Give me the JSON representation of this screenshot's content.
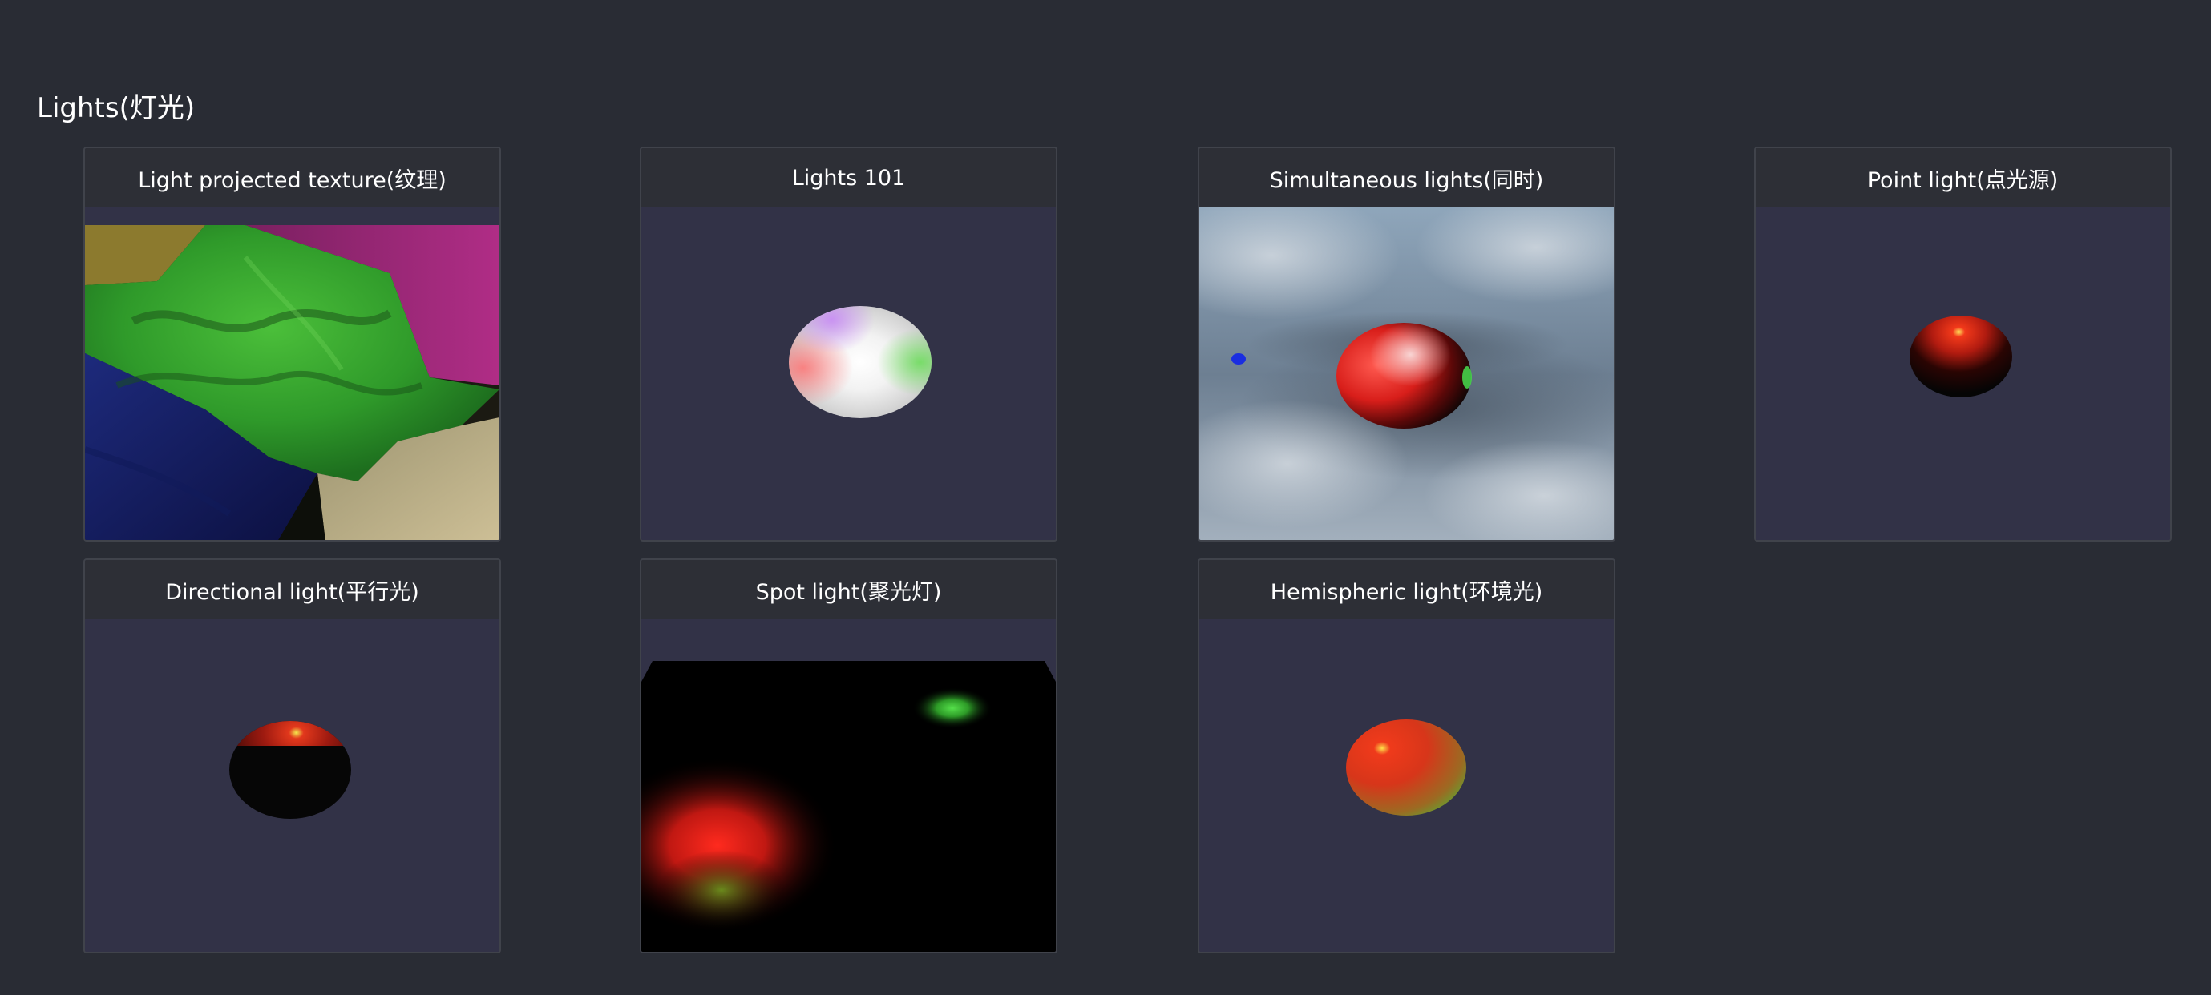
{
  "section": {
    "title": "Lights(灯光)"
  },
  "cards": [
    {
      "title": "Light projected texture(纹理)"
    },
    {
      "title": "Lights 101"
    },
    {
      "title": "Simultaneous lights(同时)"
    },
    {
      "title": "Point light(点光源)"
    },
    {
      "title": "Directional light(平行光)"
    },
    {
      "title": "Spot light(聚光灯)"
    },
    {
      "title": "Hemispheric light(环境光)"
    }
  ],
  "colors": {
    "page_background": "#292c34",
    "card_background": "#323247",
    "card_header": "#2d2f36",
    "card_border": "#40434b",
    "text": "#ffffff"
  }
}
